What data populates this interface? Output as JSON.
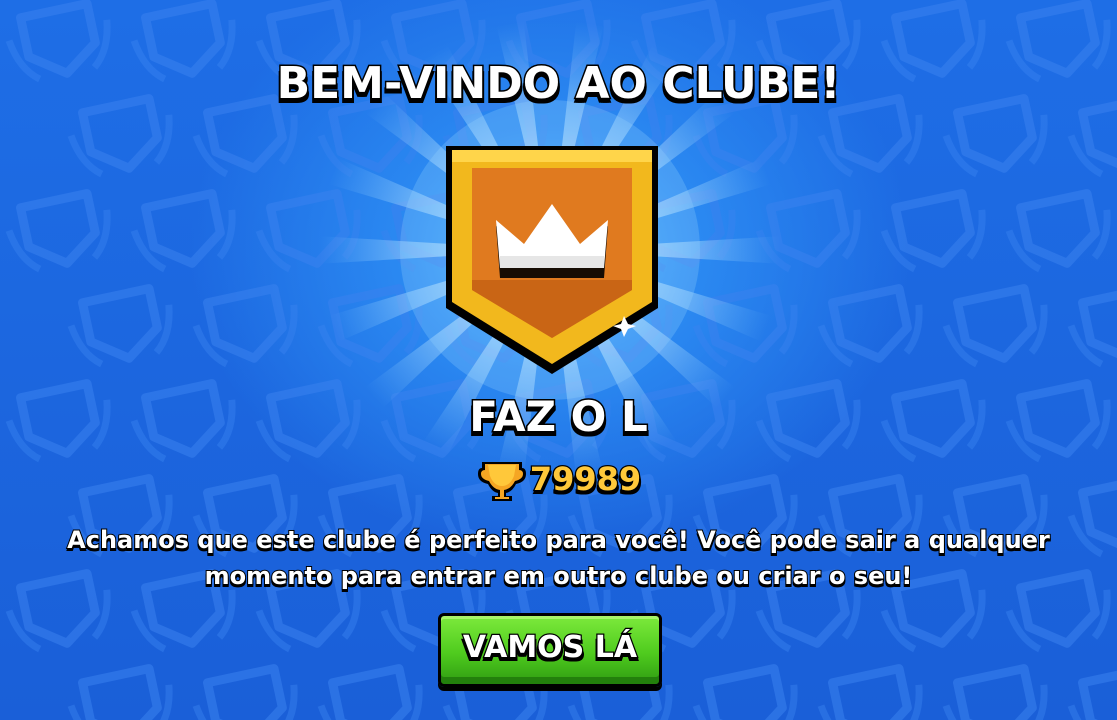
{
  "screen": {
    "title": "BEM-VINDO AO CLUBE!"
  },
  "club": {
    "name": "FAZ O L",
    "trophies": "79989",
    "badge_icon": "crown-badge-icon"
  },
  "message": "Achamos que este clube é perfeito para você! Você pode sair a qualquer momento para entrar em outro clube ou criar o seu!",
  "actions": {
    "confirm_label": "VAMOS LÁ"
  },
  "colors": {
    "background": "#1a63e0",
    "badge_gold": "#f2b81d",
    "badge_orange": "#e07a1f",
    "trophy_text": "#ffc83a",
    "button_green": "#4fcb1e"
  }
}
